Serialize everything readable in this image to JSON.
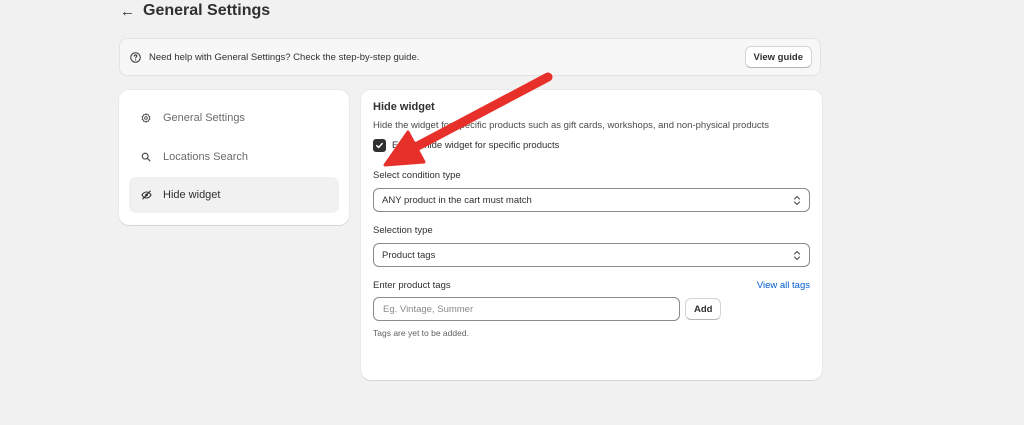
{
  "header": {
    "back_icon": "arrow-left-icon",
    "title": "General Settings"
  },
  "banner": {
    "icon": "question-circle-icon",
    "text": "Need help with General Settings? Check the step-by-step guide.",
    "button_label": "View guide"
  },
  "sidebar": {
    "items": [
      {
        "label": "General Settings",
        "icon": "gear-icon",
        "active": false
      },
      {
        "label": "Locations Search",
        "icon": "search-icon",
        "active": false
      },
      {
        "label": "Hide widget",
        "icon": "eye-off-icon",
        "active": true
      }
    ]
  },
  "hide_widget": {
    "title": "Hide widget",
    "description": "Hide the widget for specific products such as gift cards, workshops, and non-physical products",
    "checkbox_label": "Enable hide widget for specific products",
    "checkbox_checked": true,
    "condition_label": "Select condition type",
    "condition_value": "ANY product in the cart must match",
    "selection_label": "Selection type",
    "selection_value": "Product tags",
    "tags_label": "Enter product tags",
    "view_all_tags": "View all tags",
    "tags_placeholder": "Eg. Vintage, Summer",
    "add_label": "Add",
    "helper_text": "Tags are yet to be added."
  },
  "colors": {
    "background": "#f1f1f1",
    "link": "#005bd3",
    "annotation_arrow": "#e8302a"
  }
}
